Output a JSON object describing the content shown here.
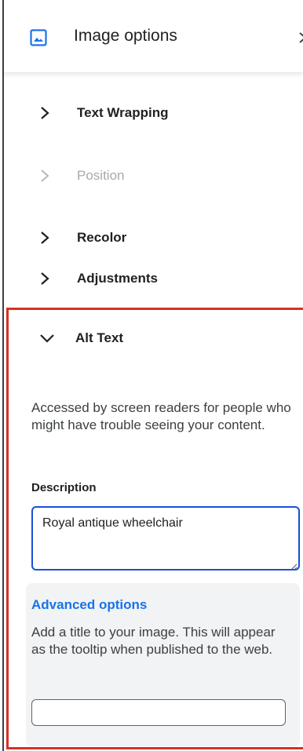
{
  "panel": {
    "title": "Image options",
    "title_icon": "image-icon",
    "close_icon": "close-chevron-icon"
  },
  "sections": {
    "text_wrapping": {
      "label": "Text Wrapping",
      "state": "collapsed",
      "enabled": true
    },
    "position": {
      "label": "Position",
      "state": "collapsed",
      "enabled": false
    },
    "recolor": {
      "label": "Recolor",
      "state": "collapsed",
      "enabled": true
    },
    "adjustments": {
      "label": "Adjustments",
      "state": "collapsed",
      "enabled": true
    }
  },
  "alt_text": {
    "label": "Alt Text",
    "state": "expanded",
    "help_text": "Accessed by screen readers for people who might have trouble seeing your content.",
    "description_label": "Description",
    "description_value": "Royal antique wheelchair",
    "advanced": {
      "title": "Advanced options",
      "help_text": "Add a title to your image. This will appear as the tooltip when published to the web.",
      "title_value": ""
    }
  },
  "colors": {
    "accent_blue": "#1a73e8",
    "focus_border": "#1a4fd6",
    "highlight_red": "#d93025",
    "disabled_text": "#a7a9ac"
  }
}
